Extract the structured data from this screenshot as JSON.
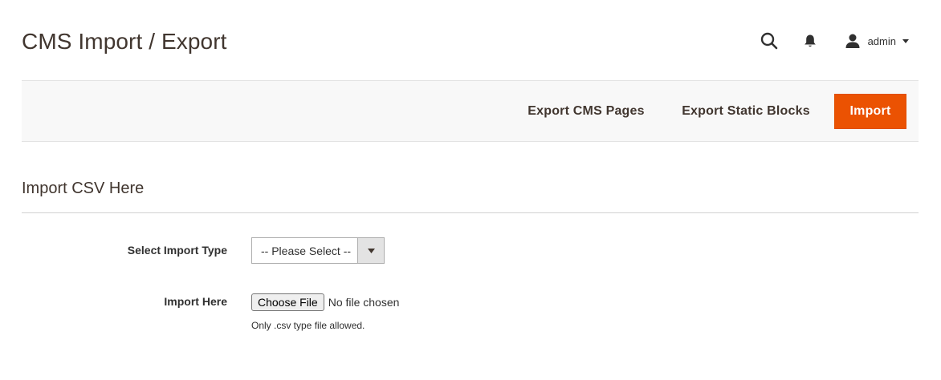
{
  "header": {
    "title": "CMS Import / Export",
    "user_name": "admin",
    "icons": [
      "search-icon",
      "bell-icon",
      "user-icon",
      "caret-down-icon"
    ]
  },
  "toolbar": {
    "export_pages_label": "Export CMS Pages",
    "export_blocks_label": "Export Static Blocks",
    "import_label": "Import"
  },
  "form": {
    "section_title": "Import CSV Here",
    "import_type": {
      "label": "Select Import Type",
      "selected": "-- Please Select --"
    },
    "import_file": {
      "label": "Import Here",
      "button_label": "Choose File",
      "status": "No file chosen",
      "note": "Only .csv type file allowed."
    }
  },
  "colors": {
    "accent": "#eb5202",
    "title_text": "#41362f",
    "bar_background": "#f8f8f8"
  }
}
